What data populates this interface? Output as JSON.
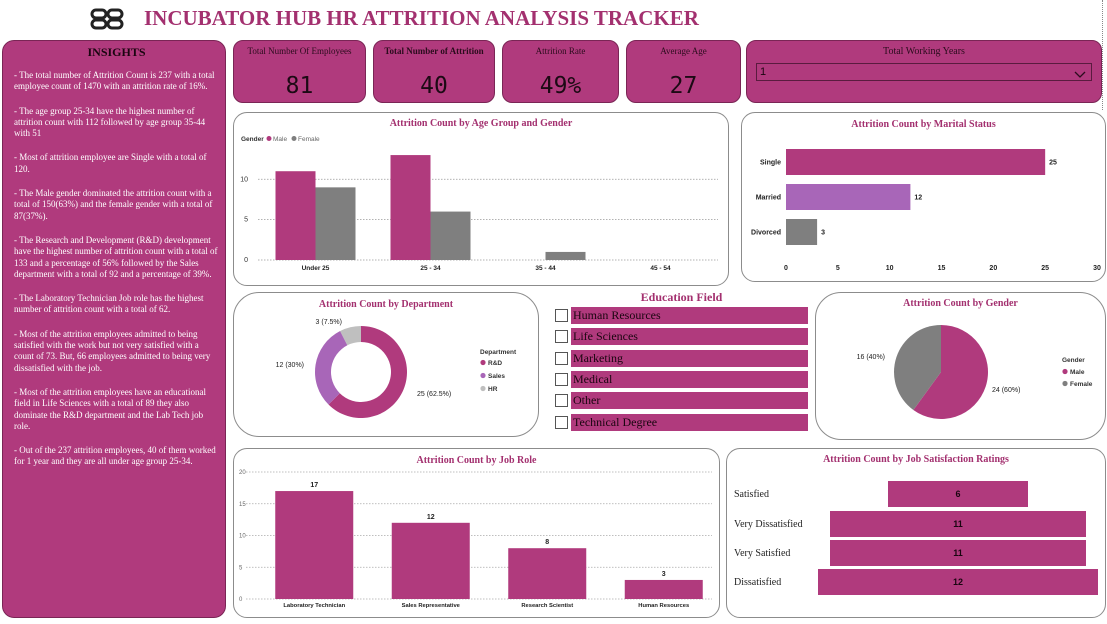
{
  "header": {
    "title": "INCUBATOR HUB HR ATTRITION ANALYSIS TRACKER"
  },
  "insights": {
    "heading": "INSIGHTS",
    "items": [
      "- The total number of Attrition Count is 237 with a total employee count of 1470 with an attrition rate of 16%.",
      "- The age group 25-34 have the highest number of attrition count with 112 followed by age group 35-44 with 51",
      "- Most of attrition employee are Single with a total of 120.",
      "- The Male gender dominated the attrition count with a total of 150(63%) and the female gender with a total of 87(37%).",
      "- The Research and Development (R&D) development have the highest number of attrition count with a total of 133 and a percentage of 56% followed by the Sales department with a total of 92 and a percentage of 39%.",
      "- The Laboratory Technician Job role has the highest number of attrition count with a total of 62.",
      "- Most of the attrition employees admitted to being satisfied with the work but not very satisfied with a count of 73. But, 66 employees admitted to being very dissatisfied with the job.",
      "- Most of the attrition employees have an educational field in Life Sciences with a total of 89 they also dominate the R&D department and the Lab Tech job role.",
      "- Out of the 237 attrition employees, 40 of them worked for 1 year and they are all under age group 25-34."
    ]
  },
  "kpis": {
    "total_employees": {
      "label": "Total Number Of Employees",
      "value": "81"
    },
    "total_attrition": {
      "label": "Total Number of Attrition",
      "value": "40"
    },
    "attrition_rate": {
      "label": "Attrition Rate",
      "value": "49%"
    },
    "average_age": {
      "label": "Average Age",
      "value": "27"
    }
  },
  "working_years": {
    "label": "Total Working Years",
    "selected": "1"
  },
  "education_field": {
    "title": "Education Field",
    "options": [
      "Human Resources",
      "Life Sciences",
      "Marketing",
      "Medical",
      "Other",
      "Technical Degree"
    ]
  },
  "colors": {
    "magenta": "#b03a7d",
    "gray": "#7f7f7f",
    "lavender": "#a866b8",
    "light_gray": "#bfbfbf"
  },
  "chart_data": [
    {
      "id": "age_gender",
      "type": "bar",
      "title": "Attrition Count by Age Group and Gender",
      "legend_title": "Gender",
      "legend_position": "top-left",
      "categories": [
        "Under 25",
        "25 - 34",
        "35 - 44",
        "45 - 54"
      ],
      "series": [
        {
          "name": "Male",
          "values": [
            11,
            13,
            0,
            0
          ]
        },
        {
          "name": "Female",
          "values": [
            9,
            6,
            1,
            0
          ]
        }
      ],
      "yticks": [
        "0",
        "5",
        "10"
      ],
      "ylim": [
        0,
        14
      ],
      "grid": true
    },
    {
      "id": "marital",
      "type": "bar",
      "orientation": "horizontal",
      "title": "Attrition Count by Marital Status",
      "categories": [
        "Single",
        "Married",
        "Divorced"
      ],
      "values": [
        25,
        12,
        3
      ],
      "xticks": [
        "0",
        "5",
        "10",
        "15",
        "20",
        "25",
        "30"
      ],
      "xlim": [
        0,
        30
      ]
    },
    {
      "id": "department",
      "type": "pie",
      "variant": "donut",
      "title": "Attrition Count by Department",
      "legend_title": "Department",
      "legend_position": "right",
      "slices": [
        {
          "name": "R&D",
          "value": 25,
          "label": "25 (62.5%)"
        },
        {
          "name": "Sales",
          "value": 12,
          "label": "12 (30%)"
        },
        {
          "name": "HR",
          "value": 3,
          "label": "3 (7.5%)"
        }
      ]
    },
    {
      "id": "gender",
      "type": "pie",
      "title": "Attrition Count by Gender",
      "legend_title": "Gender",
      "legend_position": "right",
      "slices": [
        {
          "name": "Male",
          "value": 24,
          "label": "24 (60%)"
        },
        {
          "name": "Female",
          "value": 16,
          "label": "16 (40%)"
        }
      ]
    },
    {
      "id": "job_role",
      "type": "bar",
      "title": "Attrition Count by Job Role",
      "categories": [
        "Laboratory Technician",
        "Sales Representative",
        "Research Scientist",
        "Human Resources"
      ],
      "values": [
        17,
        12,
        8,
        3
      ],
      "yticks": [
        "0",
        "5",
        "10",
        "15",
        "20"
      ],
      "ylim": [
        0,
        20
      ],
      "grid": true
    },
    {
      "id": "job_satisfaction",
      "type": "bar",
      "variant": "funnel",
      "title": "Attrition Count by Job Satisfaction Ratings",
      "categories": [
        "Satisfied",
        "Very Dissatisfied",
        "Very Satisfied",
        "Dissatisfied"
      ],
      "values": [
        6,
        11,
        11,
        12
      ]
    }
  ]
}
